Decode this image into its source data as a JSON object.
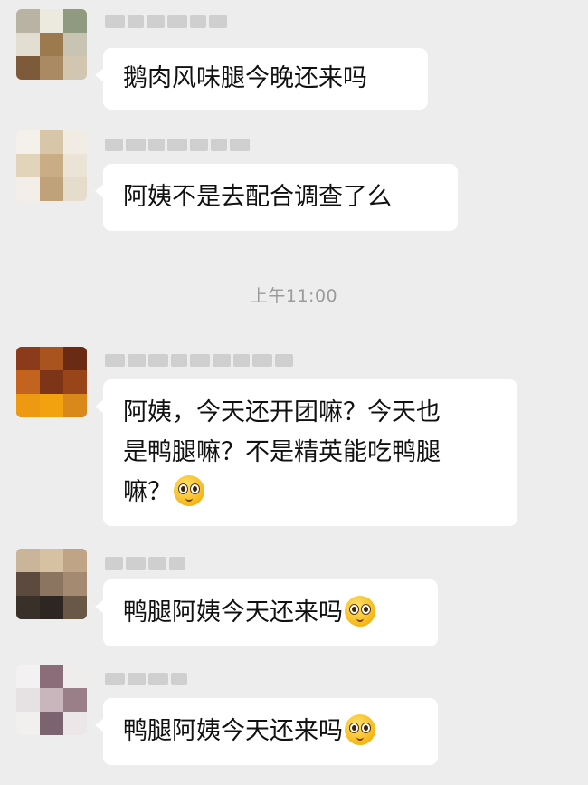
{
  "chat": {
    "timestamp": "上午11:00",
    "messages": [
      {
        "lines": [
          "鹅肉风味腿今晚还来吗"
        ],
        "emoji": ""
      },
      {
        "lines": [
          "阿姨不是去配合调查了么"
        ],
        "emoji": ""
      },
      {
        "lines": [
          "阿姨，今天还开团嘛？今天也",
          "是鸭腿嘛？不是精英能吃鸭腿",
          "嘛？"
        ],
        "emoji": "pleading-face"
      },
      {
        "lines": [
          "鸭腿阿姨今天还来吗"
        ],
        "emoji": "pleading-face"
      },
      {
        "lines": [
          "鸭腿阿姨今天还来吗"
        ],
        "emoji": "pleading-face"
      }
    ]
  },
  "colors": {
    "background": "#ededed",
    "bubble": "#ffffff",
    "timestamp_text": "#9b9b9b"
  }
}
